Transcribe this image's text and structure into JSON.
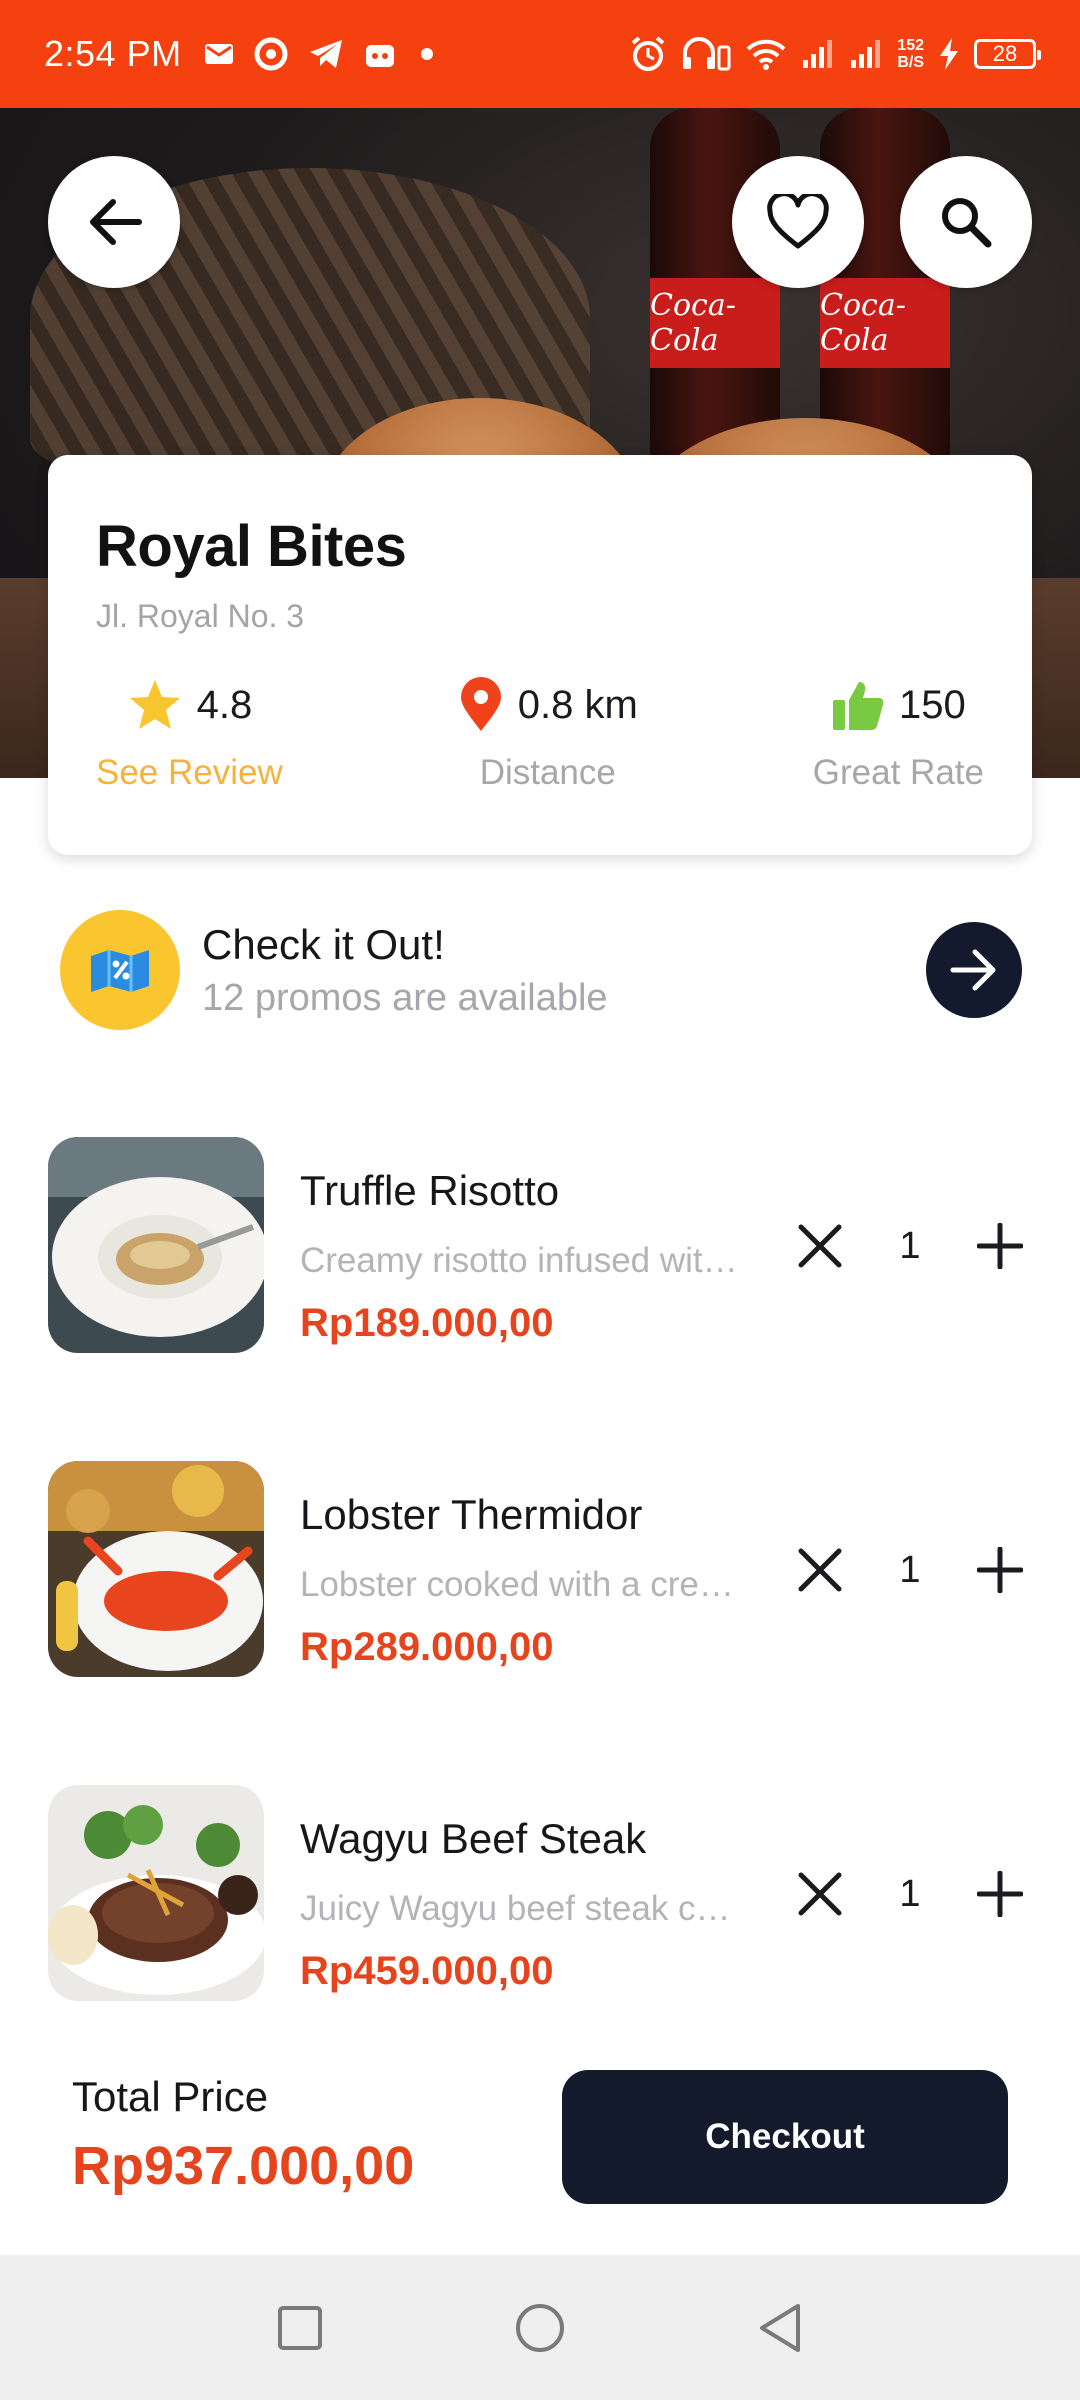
{
  "status_bar": {
    "time": "2:54 PM",
    "net_speed_value": "152",
    "net_speed_unit": "B/S",
    "battery": "28"
  },
  "header": {
    "back_icon": "arrow-left-icon",
    "favorite_icon": "heart-icon",
    "search_icon": "search-icon"
  },
  "restaurant": {
    "name": "Royal Bites",
    "address": "Jl. Royal No. 3",
    "stats": [
      {
        "icon": "star-icon",
        "value": "4.8",
        "label": "See Review"
      },
      {
        "icon": "location-pin-icon",
        "value": "0.8 km",
        "label": "Distance"
      },
      {
        "icon": "thumbs-up-icon",
        "value": "150",
        "label": "Great Rate"
      }
    ]
  },
  "promo": {
    "title": "Check it Out!",
    "subtitle": "12 promos are available"
  },
  "menu": [
    {
      "name": "Truffle Risotto",
      "description": "Creamy risotto infused with truffle",
      "price": "Rp189.000,00",
      "quantity": "1"
    },
    {
      "name": "Lobster Thermidor",
      "description": "Lobster cooked with a creamy sauce",
      "price": "Rp289.000,00",
      "quantity": "1"
    },
    {
      "name": "Wagyu Beef Steak",
      "description": "Juicy Wagyu beef steak cooked",
      "price": "Rp459.000,00",
      "quantity": "1"
    }
  ],
  "footer": {
    "total_label": "Total Price",
    "total_value": "Rp937.000,00",
    "checkout_label": "Checkout"
  },
  "colors": {
    "status_bar": "#f5410f",
    "price": "#e5441c",
    "dark_button": "#131a2c",
    "star": "#f9c630",
    "review_label": "#f6b23a",
    "pin": "#f0431b",
    "thumb": "#7ac943"
  }
}
